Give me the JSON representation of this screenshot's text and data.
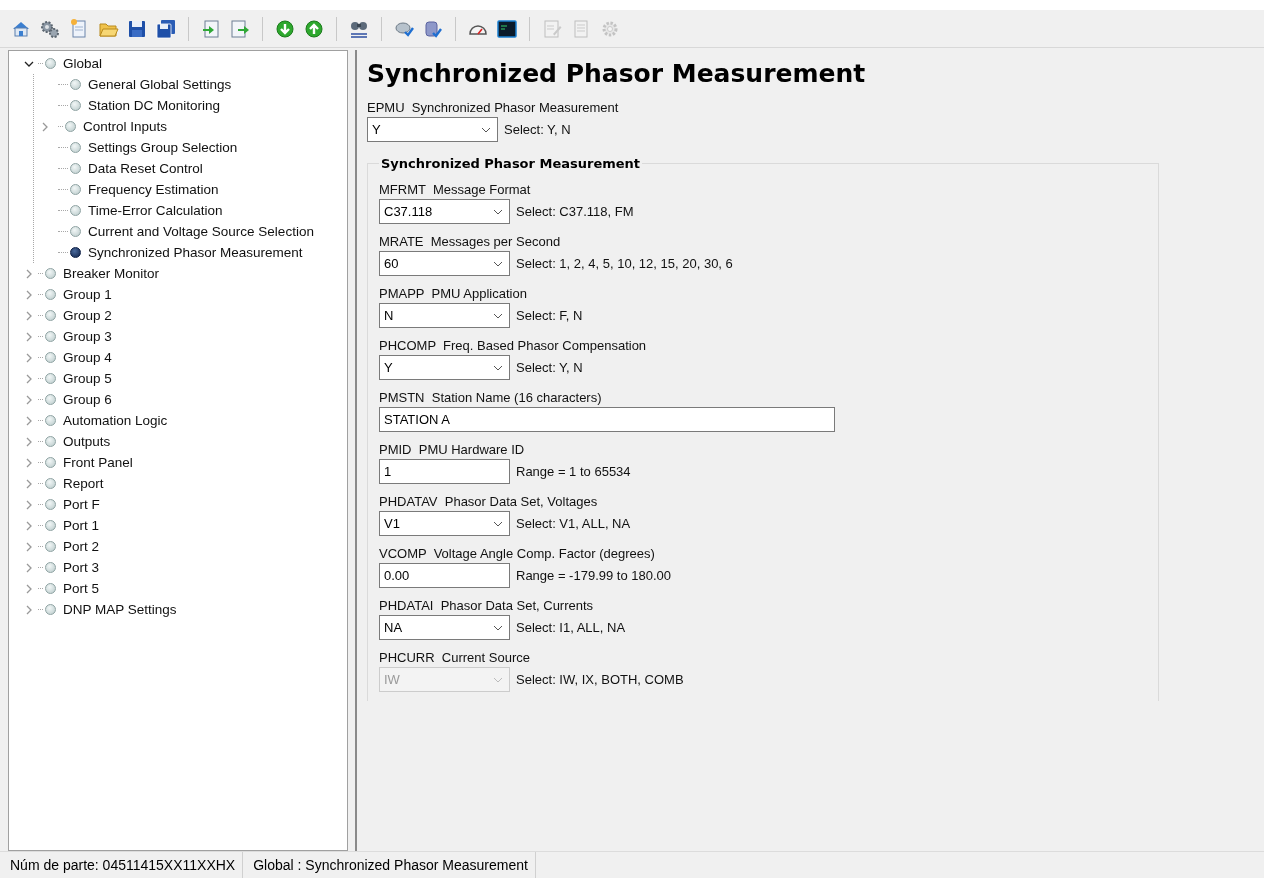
{
  "toolbar": [
    {
      "kind": "home",
      "disabled": false
    },
    {
      "kind": "gears",
      "disabled": false
    },
    {
      "kind": "new",
      "disabled": false
    },
    {
      "kind": "folder",
      "disabled": false
    },
    {
      "kind": "save",
      "disabled": false
    },
    {
      "kind": "saveall",
      "disabled": false
    },
    {
      "kind": "sep"
    },
    {
      "kind": "import",
      "disabled": false
    },
    {
      "kind": "export",
      "disabled": false
    },
    {
      "kind": "sep"
    },
    {
      "kind": "down",
      "disabled": false
    },
    {
      "kind": "up",
      "disabled": false
    },
    {
      "kind": "sep"
    },
    {
      "kind": "binoculars",
      "disabled": false
    },
    {
      "kind": "sep"
    },
    {
      "kind": "diskcheck",
      "disabled": false
    },
    {
      "kind": "dbcheck",
      "disabled": false
    },
    {
      "kind": "sep"
    },
    {
      "kind": "gauge",
      "disabled": false
    },
    {
      "kind": "terminal",
      "disabled": false
    },
    {
      "kind": "sep"
    },
    {
      "kind": "editdoc",
      "disabled": true
    },
    {
      "kind": "doc",
      "disabled": true
    },
    {
      "kind": "gear",
      "disabled": true
    }
  ],
  "tree": [
    {
      "label": "Global",
      "kind": "branch",
      "expanded": true,
      "selected": false,
      "children": [
        {
          "label": "General Global Settings",
          "kind": "leaf",
          "selected": false
        },
        {
          "label": "Station DC Monitoring",
          "kind": "leaf",
          "selected": false
        },
        {
          "label": "Control Inputs",
          "kind": "branch",
          "expanded": false,
          "selected": false
        },
        {
          "label": "Settings Group Selection",
          "kind": "leaf",
          "selected": false
        },
        {
          "label": "Data Reset Control",
          "kind": "leaf",
          "selected": false
        },
        {
          "label": "Frequency Estimation",
          "kind": "leaf",
          "selected": false
        },
        {
          "label": "Time-Error Calculation",
          "kind": "leaf",
          "selected": false
        },
        {
          "label": "Current and Voltage Source Selection",
          "kind": "leaf",
          "selected": false
        },
        {
          "label": "Synchronized Phasor Measurement",
          "kind": "leaf",
          "selected": true
        }
      ]
    },
    {
      "label": "Breaker Monitor",
      "kind": "branch",
      "expanded": false,
      "selected": false
    },
    {
      "label": "Group 1",
      "kind": "branch",
      "expanded": false,
      "selected": false
    },
    {
      "label": "Group 2",
      "kind": "branch",
      "expanded": false,
      "selected": false
    },
    {
      "label": "Group 3",
      "kind": "branch",
      "expanded": false,
      "selected": false
    },
    {
      "label": "Group 4",
      "kind": "branch",
      "expanded": false,
      "selected": false
    },
    {
      "label": "Group 5",
      "kind": "branch",
      "expanded": false,
      "selected": false
    },
    {
      "label": "Group 6",
      "kind": "branch",
      "expanded": false,
      "selected": false
    },
    {
      "label": "Automation Logic",
      "kind": "branch",
      "expanded": false,
      "selected": false
    },
    {
      "label": "Outputs",
      "kind": "branch",
      "expanded": false,
      "selected": false
    },
    {
      "label": "Front Panel",
      "kind": "branch",
      "expanded": false,
      "selected": false
    },
    {
      "label": "Report",
      "kind": "branch",
      "expanded": false,
      "selected": false
    },
    {
      "label": "Port F",
      "kind": "branch",
      "expanded": false,
      "selected": false
    },
    {
      "label": "Port 1",
      "kind": "branch",
      "expanded": false,
      "selected": false
    },
    {
      "label": "Port 2",
      "kind": "branch",
      "expanded": false,
      "selected": false
    },
    {
      "label": "Port 3",
      "kind": "branch",
      "expanded": false,
      "selected": false
    },
    {
      "label": "Port 5",
      "kind": "branch",
      "expanded": false,
      "selected": false
    },
    {
      "label": "DNP MAP Settings",
      "kind": "branch",
      "expanded": false,
      "selected": false
    }
  ],
  "page": {
    "title": "Synchronized Phasor Measurement",
    "fields": [
      {
        "label": "EPMU  Synchronized Phasor Measurement",
        "kind": "select",
        "value": "Y",
        "hint": "Select: Y, N",
        "disabled": false
      }
    ],
    "group": {
      "title": "Synchronized Phasor Measurement",
      "fields": [
        {
          "label": "MFRMT  Message Format",
          "kind": "select",
          "value": "C37.118",
          "hint": "Select: C37.118, FM",
          "disabled": false
        },
        {
          "label": "MRATE  Messages per Second",
          "kind": "select",
          "value": "60",
          "hint": "Select: 1, 2, 4, 5, 10, 12, 15, 20, 30, 6",
          "disabled": false
        },
        {
          "label": "PMAPP  PMU Application",
          "kind": "select",
          "value": "N",
          "hint": "Select: F, N",
          "disabled": false
        },
        {
          "label": "PHCOMP  Freq. Based Phasor Compensation",
          "kind": "select",
          "value": "Y",
          "hint": "Select: Y, N",
          "disabled": false
        },
        {
          "label": "PMSTN  Station Name (16 characters)",
          "kind": "long-text",
          "value": "STATION A",
          "disabled": false
        },
        {
          "label": "PMID  PMU Hardware ID",
          "kind": "text",
          "value": "1",
          "hint": "Range = 1 to 65534",
          "disabled": false
        },
        {
          "label": "PHDATAV  Phasor Data Set, Voltages",
          "kind": "select",
          "value": "V1",
          "hint": "Select: V1, ALL, NA",
          "disabled": false
        },
        {
          "label": "VCOMP  Voltage Angle Comp. Factor (degrees)",
          "kind": "text",
          "value": "0.00",
          "hint": "Range = -179.99 to 180.00",
          "disabled": false
        },
        {
          "label": "PHDATAI  Phasor Data Set, Currents",
          "kind": "select",
          "value": "NA",
          "hint": "Select: I1, ALL, NA",
          "disabled": false
        },
        {
          "label": "PHCURR  Current Source",
          "kind": "select",
          "value": "IW",
          "hint": "Select: IW, IX, BOTH, COMB",
          "disabled": true
        }
      ]
    }
  },
  "status_bar": [
    "Núm de parte: 04511415XX11XXHX",
    "Global : Synchronized Phasor Measurement"
  ]
}
